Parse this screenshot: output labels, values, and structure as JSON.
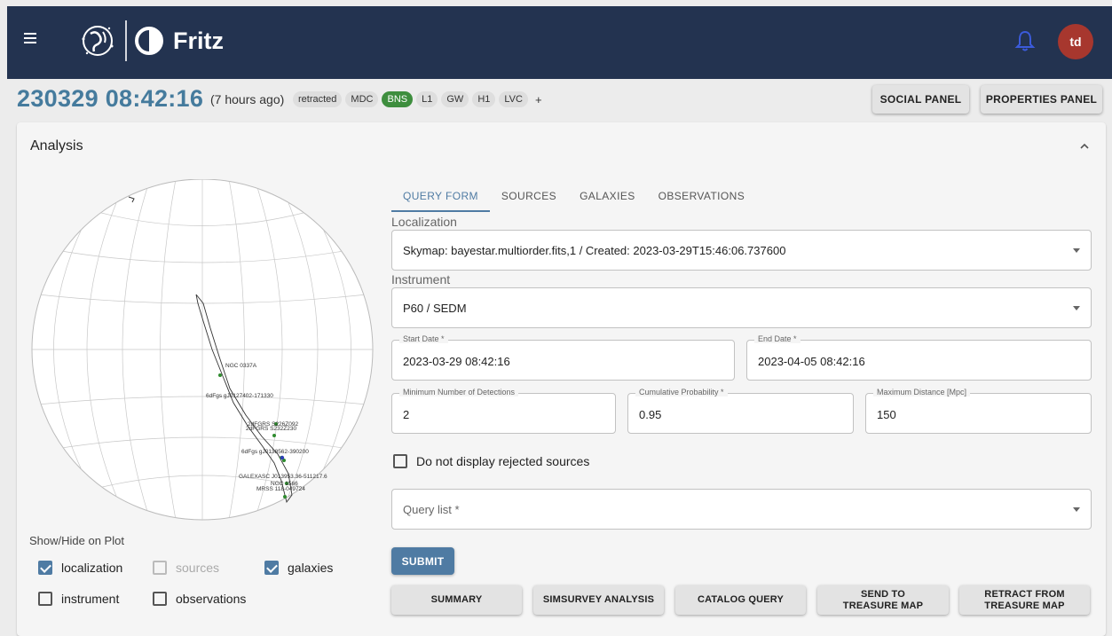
{
  "appbar": {
    "brand": "Fritz",
    "avatar_initials": "td"
  },
  "header": {
    "title": "230329 08:42:16",
    "ago": "(7 hours ago)",
    "tags": [
      "retracted",
      "MDC",
      "BNS",
      "L1",
      "GW",
      "H1",
      "LVC"
    ],
    "tag_add": "+",
    "social_panel": "SOCIAL PANEL",
    "properties_panel": "PROPERTIES PANEL"
  },
  "analysis": {
    "title": "Analysis",
    "plot_labels": [
      "NGC 0337A",
      "6dFgs gJ0127402-171330",
      "2dFGRS S226Z092",
      "2dFGRS S232Z230",
      "6dFgs gJ0138562-390200",
      "GALEXASC J013953.36-511217.6",
      "NGC 1566",
      "MRSS 118-049724"
    ],
    "show_hide_label": "Show/Hide on Plot",
    "checkboxes": {
      "localization": "localization",
      "sources": "sources",
      "galaxies": "galaxies",
      "instrument": "instrument",
      "observations": "observations"
    }
  },
  "tabs": [
    "QUERY FORM",
    "SOURCES",
    "GALAXIES",
    "OBSERVATIONS"
  ],
  "form": {
    "localization_label": "Localization",
    "localization_value": "Skymap: bayestar.multiorder.fits,1 / Created: 2023-03-29T15:46:06.737600",
    "instrument_label": "Instrument",
    "instrument_value": "P60 / SEDM",
    "start_date_label": "Start Date *",
    "start_date_value": "2023-03-29 08:42:16",
    "end_date_label": "End Date *",
    "end_date_value": "2023-04-05 08:42:16",
    "min_detections_label": "Minimum Number of Detections",
    "min_detections_value": "2",
    "cum_prob_label": "Cumulative Probability *",
    "cum_prob_value": "0.95",
    "max_dist_label": "Maximum Distance [Mpc]",
    "max_dist_value": "150",
    "reject_label": "Do not display rejected sources",
    "query_list_placeholder": "Query list *",
    "submit": "SUBMIT"
  },
  "actions": {
    "summary": "SUMMARY",
    "simsurvey": "SIMSURVEY ANALYSIS",
    "catalog": "CATALOG QUERY",
    "send_treasure": "SEND TO TREASURE MAP",
    "retract_treasure": "RETRACT FROM TREASURE MAP"
  },
  "colors": {
    "appbar": "#233350",
    "accent": "#4f7ba3",
    "title": "#457b9d",
    "avatar": "#a7372e",
    "bns_tag": "#3e8e3e",
    "bell": "#3b5bdb"
  }
}
